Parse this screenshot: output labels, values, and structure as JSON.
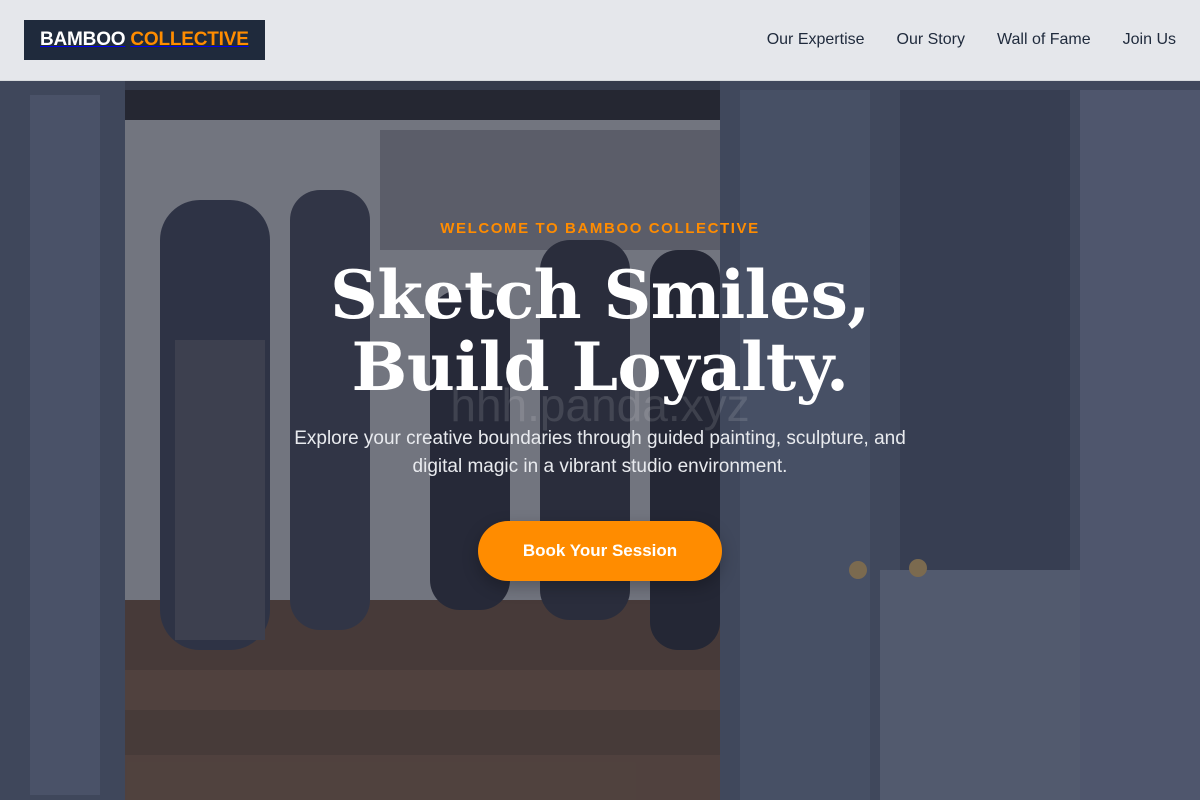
{
  "brand": {
    "word1": "BAMBOO",
    "word2": "COLLECTIVE",
    "accent_color": "#ff8c00",
    "dark_color": "#1f2a3c"
  },
  "nav": {
    "items": [
      {
        "label": "Our Expertise"
      },
      {
        "label": "Our Story"
      },
      {
        "label": "Wall of Fame"
      },
      {
        "label": "Join Us"
      }
    ]
  },
  "hero": {
    "eyebrow": "WELCOME TO BAMBOO COLLECTIVE",
    "headline": "Sketch Smiles, Build Loyalty.",
    "subhead": "Explore your creative boundaries through guided painting, sculpture, and digital magic in a vibrant studio environment.",
    "cta_label": "Book Your Session",
    "watermark": "hhh.panda.xyz",
    "background_image": "art-studio-gallery-photo"
  }
}
